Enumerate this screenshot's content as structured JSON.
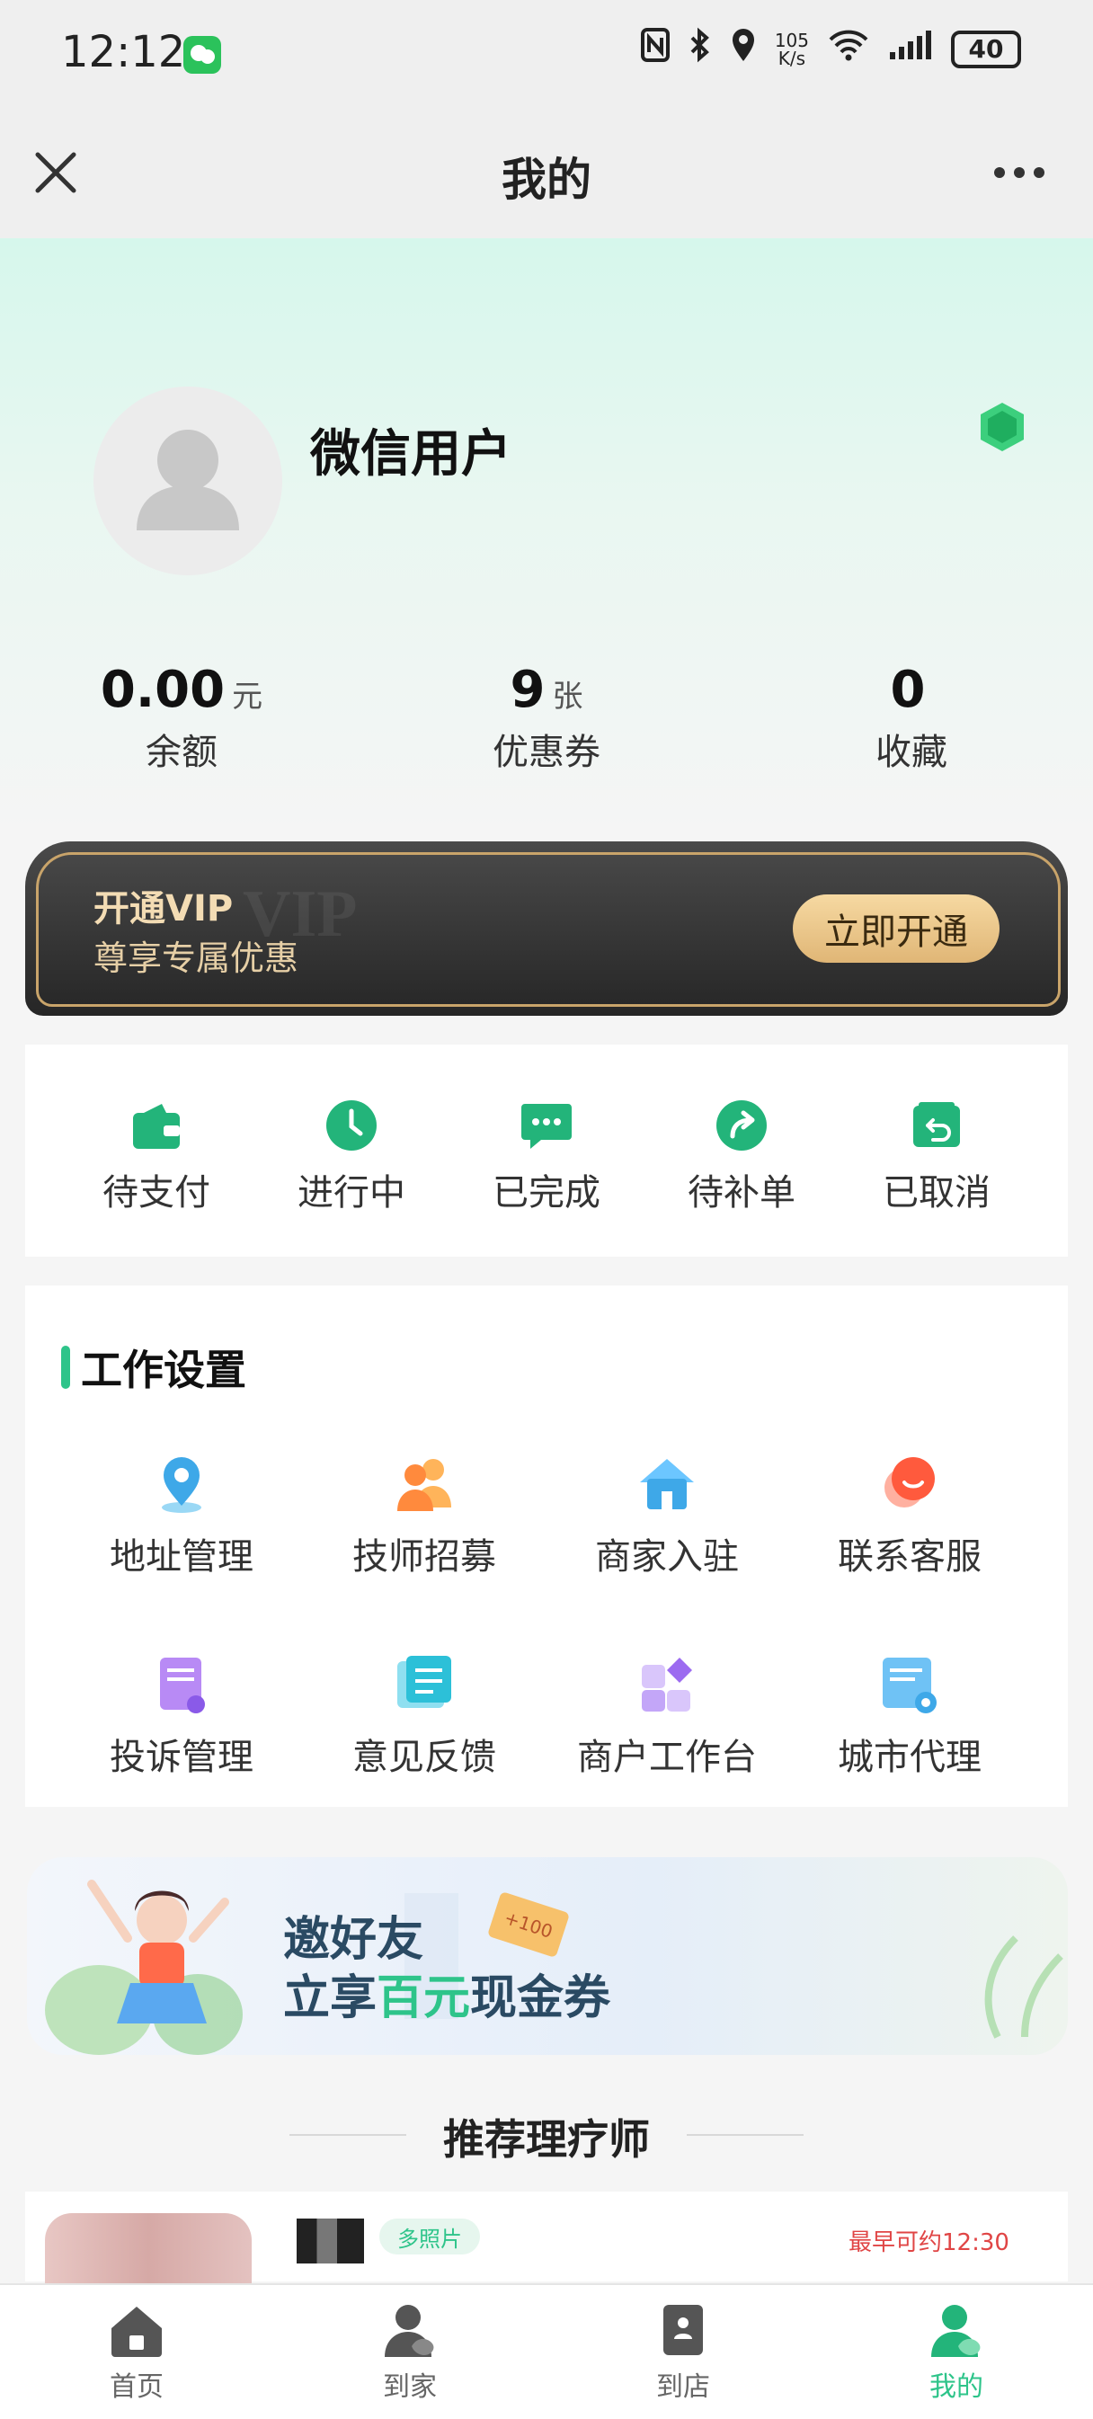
{
  "status_bar": {
    "time": "12:12",
    "net_speed": "105\nK/s",
    "battery": "40"
  },
  "nav": {
    "title": "我的"
  },
  "profile": {
    "name": "微信用户"
  },
  "stats": [
    {
      "value": "0.00",
      "unit": "元",
      "label": "余额"
    },
    {
      "value": "9",
      "unit": "张",
      "label": "优惠券"
    },
    {
      "value": "0",
      "unit": "",
      "label": "收藏"
    }
  ],
  "vip": {
    "title": "开通VIP",
    "watermark": "VIP",
    "subtitle": "尊享专属优惠",
    "button": "立即开通"
  },
  "orders": [
    {
      "label": "待支付",
      "icon": "wallet-icon"
    },
    {
      "label": "进行中",
      "icon": "clock-icon"
    },
    {
      "label": "已完成",
      "icon": "chat-icon"
    },
    {
      "label": "待补单",
      "icon": "share-arrow-icon"
    },
    {
      "label": "已取消",
      "icon": "return-icon"
    }
  ],
  "work": {
    "title": "工作设置",
    "items": [
      {
        "label": "地址管理",
        "icon": "location-icon"
      },
      {
        "label": "技师招募",
        "icon": "people-icon"
      },
      {
        "label": "商家入驻",
        "icon": "house-icon"
      },
      {
        "label": "联系客服",
        "icon": "service-icon"
      },
      {
        "label": "投诉管理",
        "icon": "complaint-icon"
      },
      {
        "label": "意见反馈",
        "icon": "feedback-icon"
      },
      {
        "label": "商户工作台",
        "icon": "workbench-icon"
      },
      {
        "label": "城市代理",
        "icon": "agent-icon"
      }
    ]
  },
  "invite": {
    "line1": "邀好友",
    "line2_pre": "立享",
    "line2_hl": "百元",
    "line2_post": "现金券",
    "coupon": "+100"
  },
  "recommend": {
    "title": "推荐理疗师",
    "photos_tag": "多照片",
    "earliest": "最早可约12:30"
  },
  "tabs": [
    {
      "label": "首页",
      "icon": "home-icon"
    },
    {
      "label": "到家",
      "icon": "to-home-icon"
    },
    {
      "label": "到店",
      "icon": "to-store-icon"
    },
    {
      "label": "我的",
      "icon": "profile-icon"
    }
  ],
  "colors": {
    "accent": "#2ec48a",
    "gold": "#e0b676",
    "danger": "#e04545"
  }
}
